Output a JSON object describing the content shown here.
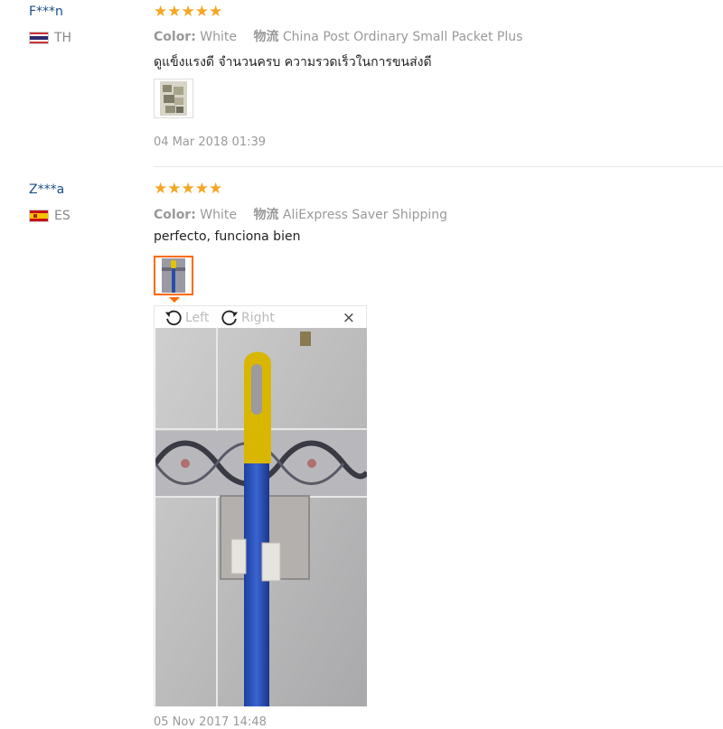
{
  "reviews": [
    {
      "user": "F***n",
      "country_code": "TH",
      "stars": "★★★★★",
      "color_label": "Color:",
      "color_value": "White",
      "shipping_label": "物流",
      "shipping_value": "China Post Ordinary Small Packet Plus",
      "text": "ดูแข็งแรงดี จำนวนครบ ความรวดเร็วในการขนส่งดี",
      "date": "04 Mar 2018 01:39"
    },
    {
      "user": "Z***a",
      "country_code": "ES",
      "stars": "★★★★★",
      "color_label": "Color:",
      "color_value": "White",
      "shipping_label": "物流",
      "shipping_value": "AliExpress Saver Shipping",
      "text": "perfecto, funciona bien",
      "date": "05 Nov 2017 14:48"
    }
  ],
  "viewer": {
    "rotate_left_label": "Left",
    "rotate_right_label": "Right",
    "close_label": "×"
  },
  "colors": {
    "accent": "#ff6a00",
    "star": "#f5a623",
    "username": "#1a4e8a"
  }
}
